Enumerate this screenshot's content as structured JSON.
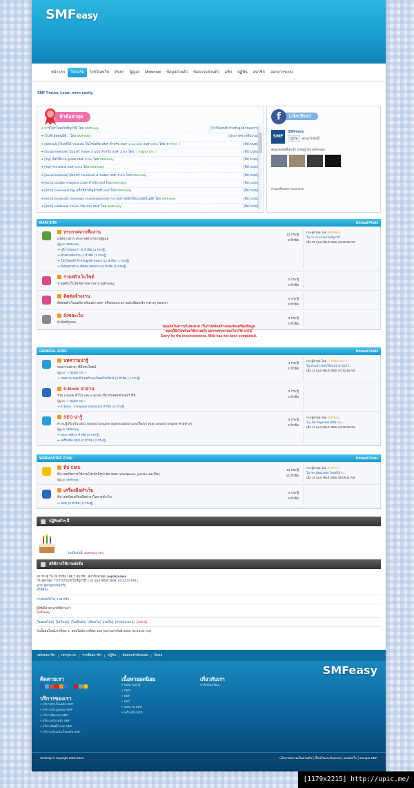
{
  "header": {
    "logo_main": "SMF",
    "logo_sub": "easy"
  },
  "nav": [
    "หน้าแรก",
    "ในบอร์ด",
    "โปรโมทเว็บ",
    "ค้นหา",
    "ผู้ดูแล",
    "Moderate",
    "ข้อมูลส่วนตัว",
    "ข้อความส่วนตัว",
    "แท็ก",
    "ปฏิทิน",
    "สมาชิก",
    "ออกจากระบบ"
  ],
  "tagline": "SMF Forum. Learn more easily.",
  "news": {
    "title": "หัวข้อล่าสุด",
    "rows": [
      {
        "l": "การโปรโมทเว็บที่ถูกวิธี",
        "by": "SMFeasy",
        "r": "[โปรโมทฟรี สำหรับลูกค้าของเรา]"
      },
      {
        "l": "เว็บทำอัตตนุมัติ...",
        "by": "SMFeasy",
        "r": "[ประกาศจากทีมงาน]"
      },
      {
        "l": "[BBCode] โพสต์ได้ Youtube ในโรบอร์ด SMF สำหรับ SMF 1.1.x และ SMF 2.0.x",
        "by": "★ RYO ☆",
        "r": "[ทิป CMS]"
      },
      {
        "l": "[Social Network] ปุ่มแชร์ Twitter 2 แบบ สำหรับ SMF 2.0.x",
        "by": "☆ Nightz Oo ☆",
        "r": "[ทิป CMS]"
      },
      {
        "l": "[Tip] เปิดใช้งาน ดูแลด SMF 2.0.x",
        "by": "SMFeasy",
        "r": "[ทิป CMS]"
      },
      {
        "l": "[Tip] Permalink SMF 2.0.x",
        "by": "SMFeasy",
        "r": "[ทิป CMS]"
      },
      {
        "l": "[Social Network] ปุ่มแชร์ Facebook & Twitter SMF 2.0.x",
        "by": "SMFeasy",
        "r": "[ทิป CMS]"
      },
      {
        "l": "[SEO] Google Analytics Code สำหรับ smf",
        "by": "SMFeasy",
        "r": "[ทิป CMS]"
      },
      {
        "l": "[SEO] Canonical Tag แท็กที่สำคัญสำหรับ smf",
        "by": "SMFeasy",
        "r": "[ทิป CMS]"
      },
      {
        "l": "[SEO] Keywords Generator (AutoKeywords) For SMF ส่งผิดให้แบบอัตโนมัติ",
        "by": "SMFeasy",
        "r": "[ทิป CMS]"
      },
      {
        "l": "[SEO] Additional Forum Title For SMF",
        "by": "SMFeasy",
        "r": "[ทิป CMS]"
      }
    ]
  },
  "facebook": {
    "title": "Like Box!",
    "page": "SMFeasy",
    "like": "ถูกใจ",
    "count": "คุณถูกใจสิ่งนี้",
    "people": "คุณและคนอื่นๆ อีก 3 คนถูกใจ SMFeasy",
    "plugin": "ส่วนเสริมของ Facebook"
  },
  "cats": [
    {
      "name": "MAIN SITE",
      "unread": "Unread Posts",
      "boards": [
        {
          "title": "ประกาศจากทีมงาน",
          "desc": "แจ้งข่าวสาร ประกาศต่างๆจากผู้ดูแล",
          "mod": "ผู้ดูแล: ",
          "modName": "SMFeasy",
          "subs": [
            "บริการของเรา (5 หัวข้อ | 5 กระทู้)",
            "ตัวอย่างผลงาน (1 หัวข้อ | 1 กระทู้)",
            "โปรโมทฟรี สำหรับลูกค้าของเรา (1 หัวข้อ | 1 กระทู้)",
            "ฝั่งปัญหาต่างๆ ติดต่อ สอบถาม (0 หัวข้อ | 0 กระทู้)"
          ],
          "s1": "12 กระทู้",
          "s2": "9 หัวข้อ",
          "last": "กระทู้ล่าสุด โดย ",
          "lastBy": "SMFeasy",
          "lastIn": "ใน การโปรโมทเว็บที่ถูกวิธี",
          "lastDate": "เมื่อ 20 กุมภาพันธ์ 2556, 03:22:32 PM"
        },
        {
          "title": "รายสตัวเว็บไซต์",
          "desc": "ขายสตัวเว็บไซต์ต่างๆจากทาง SMFeasy",
          "mod": "",
          "modName": "",
          "subs": [],
          "s1": "0 กระทู้",
          "s2": "0 หัวข้อ",
          "last": "",
          "lastBy": "",
          "lastIn": "",
          "lastDate": ""
        },
        {
          "title": "ติดต่อจ้างงาน",
          "desc": "ติดต่อทำเว็บบอร์ด ปรับแต่ง SMF หรือสอบถามรายละเอียดบริการต่างๆ ของเรา",
          "mod": "",
          "modName": "",
          "subs": [],
          "s1": "0 กระทู้",
          "s2": "0 หัวข้อ",
          "last": "",
          "lastBy": "",
          "lastIn": "",
          "lastDate": ""
        },
        {
          "title": "ถังขยะเว็บ",
          "desc": "หัวข้อที่ถูกลบ",
          "mod": "",
          "modName": "",
          "subs": [],
          "s1": "0 กระทู้",
          "s2": "0 หัวข้อ",
          "last": "",
          "lastBy": "",
          "lastIn": "",
          "lastDate": ""
        }
      ]
    },
    {
      "name": "GENERAL ZONE",
      "unread": "Unread Posts",
      "boards": [
        {
          "title": "บทความน่ารู้",
          "desc": "บทความต่างๆ ที่มีประโยชน์",
          "mod": "ผู้ดูแล: ",
          "modName": "☆ Nightz Oo ☆",
          "subs": [
            "บทความ คอมพิวเตอร์ และอิเลคโทรนิกส์ (4 หัวข้อ | 4 กระทู้)"
          ],
          "s1": "4 กระทู้",
          "s2": "4 หัวข้อ",
          "last": "กระทู้ล่าสุด โดย ",
          "lastBy": "☆ Nightz Oo ☆",
          "lastIn": "ใน ค่อนข้างโหดให้เด่นไวกำนับไว้...",
          "lastDate": "เมื่อ 13 กุมภาพันธ์ 2556, 07:43:45 AM"
        },
        {
          "title": "E-Book น่าอ่าน",
          "desc": "รวม e-book ทั่วไป และ e-book เกี่ยวกับคอมพิวเตอร์ ที่นี่",
          "mod": "ผู้ดูแล: ",
          "modName": "☆ Nightz Oo ☆",
          "subs": [
            "E-Book - Computer Internet (0 หัวข้อ | 0 กระทู้)"
          ],
          "s1": "0 กระทู้",
          "s2": "0 หัวข้อ",
          "last": "",
          "lastBy": "",
          "lastIn": "",
          "lastDate": ""
        },
        {
          "title": "SEO น่ารู้",
          "desc": "ความรู้เกี่ยวกับ SEO (Search Engine Optimization) และเรื่องราวของ Search Engine ค่ายต่างๆ",
          "mod": "ผู้ดูแล: ",
          "modName": "SMFeasy",
          "subs": [
            "SEO Talk (0 หัวข้อ | 0 กระทู้)",
            "เครื่องมือ SEO (2 หัวข้อ | 2 กระทู้)"
          ],
          "s1": "5 กระทู้",
          "s2": "5 หัวข้อ",
          "last": "กระทู้ล่าสุด โดย ",
          "lastBy": "SMFeasy",
          "lastIn": "ใน เช็ค Pagerank (PR) กระ...",
          "lastDate": "เมื่อ 14 กุมภาพันธ์ 2556, 04:39:29 PM"
        }
      ]
    },
    {
      "name": "WEBMASTER ZONE",
      "unread": "Unread Posts",
      "boards": [
        {
          "title": "ทิป CMS",
          "desc": "ทิป-เทคนิคการใช้งานโปรดักจีรูป เช่น SMF, Wordpress, joomla และอื่นๆ",
          "mod": "ผู้ดูแล: ",
          "modName": "SMFeasy",
          "subs": [],
          "s1": "12 กระทู้",
          "s2": "11 หัวข้อ",
          "last": "กระทู้ล่าสุด โดย ",
          "lastBy": "★ RYO ☆",
          "lastIn": "ใน Re: [BBCode] โพสต์ได้ Y...",
          "lastDate": "เมื่อ 18 กุมภาพันธ์ 2556, 09:09:11 AM"
        },
        {
          "title": "เครื่องมือทำเว็บ",
          "desc": "ทิป-เทคนิคเครื่องมือต่างๆในการทำเว็บ",
          "mod": "",
          "modName": "",
          "subs": [
            "SMF (0 หัวข้อ | 0 กระทู้)"
          ],
          "s1": "0 กระทู้",
          "s2": "0 หัวข้อ",
          "last": "",
          "lastBy": "",
          "lastIn": "",
          "lastDate": ""
        }
      ]
    }
  ],
  "notice": {
    "line1": "ขออภัยในความไม่สะดวก เว็บกำลังจัดสร้างและจัดเตรียมข้อมูล",
    "line2": "ตอนนี้ยังไม่พร้อมใช้งานครับ อยากสอบถามอะไร PM มาได้",
    "line3": "Sorry for the inconvenience. Web has not been completed."
  },
  "calendar": {
    "title": "ปฏิทินทั่วๆ นี้",
    "bday_label": "วันเกิดวันนี้: ",
    "bday_name": "SMFeasy (30)"
  },
  "stats": {
    "title": "สถิติการใช้งานฟอรั่ม",
    "line1": "33 กระทู้ ใน 29 หัวข้อ โดย 7 สมาชิก. สมาชิกล่าสุด: ",
    "latest_member": "nopzkzcross",
    "line2": "กระทู้ล่าสุด: \"การโปรโมทเว็บที่ถูกวิธี\" ( 20 กุมภาพันธ์ 2556, 03:22:32 PM )",
    "link1": "ดูกระทู้ล่าสุดบนฟอรั่ม",
    "link2": "สถิติอื่นๆ",
    "online": "0 บุคคลทั่วไป, 1 สมาชิก",
    "active": "ผู้ใช้เมื่อ 30 นาทีที่ผ่านมา:",
    "active_user": "SMFeasy",
    "legend": [
      "[ไม่ออนไลน์]",
      "[ไม่มีกลุ่ม]",
      "[ไมเด็นดัง]",
      "[เขียนไม่]",
      "[เทพไม่]",
      "[ท่านประธาน]",
      "[Admin]"
    ],
    "record": "วันนี้ออนไลน์มากที่สุด: 1. ออนไลน์มากที่สุด: 120 (16 กุมภาพันธ์ 2556, 05:14:02 AM)"
  },
  "footer": {
    "top_links": [
      "สมัครสมาชิก",
      "เข้าสู่ระบบ",
      "รายชื่อสมาชิก",
      "ปฏิทิน",
      "ติดต่อหน้าข้อสงสัย",
      "ติดต่อ"
    ],
    "col1_title": "ติดตามเรา",
    "col1b_title": "บริการของเรา",
    "col1b_items": [
      "บริการทำเว็บบอร์ด SMF",
      "บริการปรับรูปแบบ SMF",
      "บริการติดเกรด SMF",
      "บริการสร้างหน้า SMF",
      "บริการติดตั้งโปรด SMF",
      "บริการปรับแต่งเว็บบอร์ด SMF"
    ],
    "col2_title": "เนื้อหายอดนิยม",
    "col2_items": [
      "บทความน่ารู้",
      "CMS",
      "SMF",
      "SEO",
      "บทความ SEO",
      "เครื่องมือ SEO"
    ],
    "col3_title": "เกี่ยวกับเรา",
    "col3_text": "กำลังจัดเตรียม...",
    "logo": "SMFeasy",
    "copyright": "Smfeasy © copyright 2012-2013",
    "bottom_links": "นโยบายความเป็นส่วนตัว | เงื่อนไขและข้อตกลง | แผนผังเว็บ | ขอบคุณ SMF"
  },
  "watermark": "[1179x2215] http://upic.me/"
}
